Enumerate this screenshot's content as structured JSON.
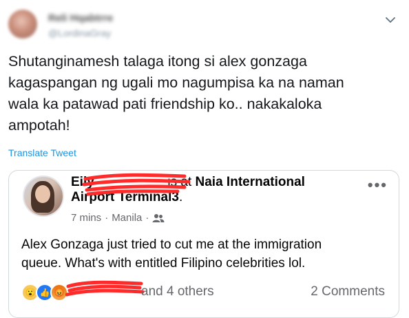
{
  "tweet": {
    "display_name": "Reli Hqabtrre",
    "handle": "@LordinaGray",
    "text_lines": [
      "Shutanginamesh talaga itong  si alex gonzaga",
      "kagaspangan ng ugali mo nagumpisa ka na naman",
      "wala ka patawad pati friendship ko.. nakakaloka",
      "ampotah!"
    ],
    "translate_label": "Translate Tweet"
  },
  "fb_post": {
    "author_visible": "Eily",
    "is_at": "is at",
    "location": "Naia International",
    "location_cont": "Airport Terminal3",
    "time": "7 mins",
    "place": "Manila",
    "post_lines": [
      "Alex Gonzaga just tried to cut me at the immigration",
      "queue. What's with entitled Filipino celebrities lol."
    ],
    "others_text": "and 4 others",
    "comments_text": "2 Comments"
  },
  "colors": {
    "link": "#1b95e0",
    "scribble": "#ff2a2a",
    "fb_meta": "#65676b"
  },
  "icons": [
    "chevron-down-icon",
    "audience-friends-icon",
    "more-dots-icon",
    "wow-reaction-icon",
    "like-reaction-icon",
    "angry-reaction-icon"
  ]
}
